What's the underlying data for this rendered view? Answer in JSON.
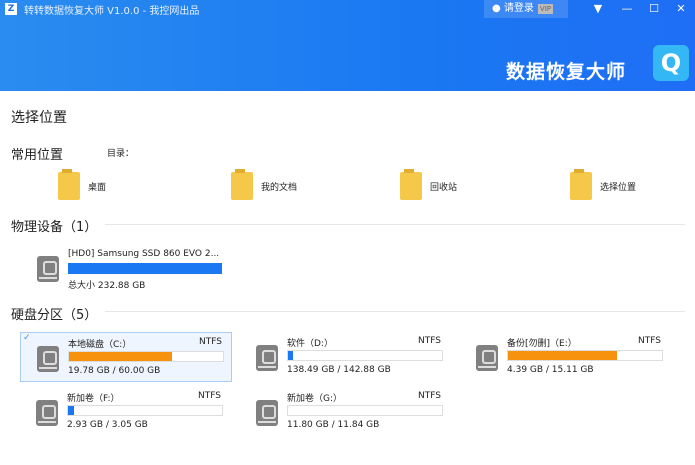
{
  "window": {
    "title": "转转数据恢复大师 V1.0.0 - 我控网出品",
    "login": "请登录",
    "vip": "VIP",
    "brand": "数据恢复大师"
  },
  "main": {
    "heading": "选择位置",
    "common_title": "常用位置",
    "dir_label": "目录：",
    "locations": [
      {
        "label": "桌面"
      },
      {
        "label": "我的文档"
      },
      {
        "label": "回收站"
      },
      {
        "label": "选择位置"
      }
    ],
    "physical_title": "物理设备（1）",
    "device": {
      "name": "[HD0] Samsung SSD 860 EVO 2...",
      "size": "总大小 232.88 GB",
      "fill": 1.0
    },
    "partition_title": "硬盘分区（5）",
    "partitions": [
      {
        "name": "本地磁盘（C:）",
        "fs": "NTFS",
        "size": "19.78 GB / 60.00 GB",
        "fill": 0.67,
        "color": "#f7920f",
        "selected": true
      },
      {
        "name": "软件（D:）",
        "fs": "NTFS",
        "size": "138.49 GB / 142.88 GB",
        "fill": 0.03,
        "color": "#1a78f2"
      },
      {
        "name": "备份[勿删]（E:）",
        "fs": "NTFS",
        "size": "4.39 GB / 15.11 GB",
        "fill": 0.71,
        "color": "#f7920f"
      },
      {
        "name": "新加卷（F:）",
        "fs": "NTFS",
        "size": "2.93 GB / 3.05 GB",
        "fill": 0.04,
        "color": "#1a78f2"
      },
      {
        "name": "新加卷（G:）",
        "fs": "NTFS",
        "size": "11.80 GB / 11.84 GB",
        "fill": 0.0,
        "color": "#1a78f2"
      }
    ]
  }
}
